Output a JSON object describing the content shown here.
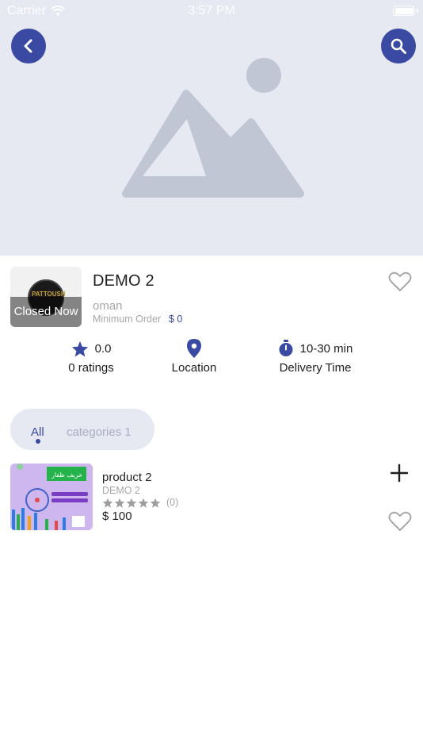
{
  "status_bar": {
    "carrier": "Carrier",
    "time": "3:57 PM"
  },
  "header": {
    "back_icon": "chevron-left-icon",
    "search_icon": "search-icon",
    "image_icon": "image-placeholder-icon"
  },
  "store": {
    "name": "DEMO 2",
    "closed_label": "Closed Now",
    "logo_text": "PATTOUSH",
    "city": "oman",
    "min_order_label": "Minimum Order",
    "min_order_value": "$ 0",
    "rating": "0.0",
    "ratings_label": "0 ratings",
    "location_label": "Location",
    "delivery_time": "10-30 min",
    "delivery_label": "Delivery Time"
  },
  "tabs": [
    {
      "label": "All",
      "active": true
    },
    {
      "label": "categories 1",
      "active": false
    }
  ],
  "products": [
    {
      "name": "product  2",
      "store": "DEMO 2",
      "stars": 0,
      "reviews": "(0)",
      "price": "$ 100",
      "image_banner_text": "خريف ظفار"
    }
  ],
  "colors": {
    "primary": "#3a4aa3",
    "hero_background": "#e6e8f2",
    "placeholder_gray": "#c0c6d4",
    "muted_text": "#a7a7a7"
  }
}
